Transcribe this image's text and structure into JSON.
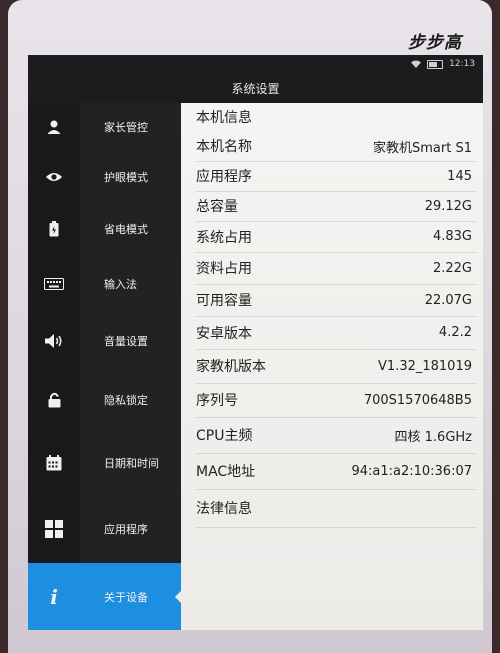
{
  "brand": "步步高",
  "status": {
    "time": "12:13"
  },
  "title": "系统设置",
  "sidebar": {
    "items": [
      {
        "label": "家长管控",
        "icon": "person-icon"
      },
      {
        "label": "护眼模式",
        "icon": "eye-icon"
      },
      {
        "label": "省电模式",
        "icon": "battery-icon"
      },
      {
        "label": "输入法",
        "icon": "keyboard-icon"
      },
      {
        "label": "音量设置",
        "icon": "speaker-icon"
      },
      {
        "label": "隐私锁定",
        "icon": "lock-icon"
      },
      {
        "label": "日期和时间",
        "icon": "calendar-icon"
      },
      {
        "label": "应用程序",
        "icon": "apps-icon"
      },
      {
        "label": "关于设备",
        "icon": "info-icon",
        "active": true
      }
    ]
  },
  "info": {
    "header": "本机信息",
    "rows": [
      {
        "key": "本机名称",
        "value": "家教机Smart S1"
      },
      {
        "key": "应用程序",
        "value": "145"
      },
      {
        "key": "总容量",
        "value": "29.12G"
      },
      {
        "key": "系统占用",
        "value": "4.83G"
      },
      {
        "key": "资料占用",
        "value": "2.22G"
      },
      {
        "key": "可用容量",
        "value": "22.07G"
      },
      {
        "key": "安卓版本",
        "value": "4.2.2"
      },
      {
        "key": "家教机版本",
        "value": "V1.32_181019"
      },
      {
        "key": "序列号",
        "value": "700S1570648B5"
      },
      {
        "key": "CPU主频",
        "value": "四核 1.6GHz"
      },
      {
        "key": "MAC地址",
        "value": "94:a1:a2:10:36:07"
      }
    ],
    "legal": "法律信息"
  },
  "colors": {
    "accent": "#1e8fe0",
    "sidebar": "#222225",
    "content_bg": "#f0f0ee"
  }
}
